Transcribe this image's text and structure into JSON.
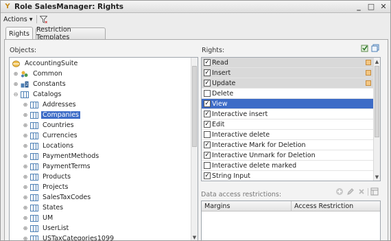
{
  "window": {
    "title": "Role SalesManager: Rights"
  },
  "toolbar": {
    "actions_label": "Actions ▾"
  },
  "tabs": [
    {
      "label": "Rights"
    },
    {
      "label": "Restriction Templates"
    }
  ],
  "objects_label": "Objects:",
  "rights_label": "Rights:",
  "tree": [
    {
      "label": "AccountingSuite"
    },
    {
      "label": "Common"
    },
    {
      "label": "Constants"
    },
    {
      "label": "Catalogs"
    },
    {
      "label": "Addresses"
    },
    {
      "label": "Companies"
    },
    {
      "label": "Countries"
    },
    {
      "label": "Currencies"
    },
    {
      "label": "Locations"
    },
    {
      "label": "PaymentMethods"
    },
    {
      "label": "PaymentTerms"
    },
    {
      "label": "Products"
    },
    {
      "label": "Projects"
    },
    {
      "label": "SalesTaxCodes"
    },
    {
      "label": "States"
    },
    {
      "label": "UM"
    },
    {
      "label": "UserList"
    },
    {
      "label": "USTaxCategories1099"
    }
  ],
  "rights": [
    {
      "label": "Read",
      "checked": true
    },
    {
      "label": "Insert",
      "checked": true
    },
    {
      "label": "Update",
      "checked": true
    },
    {
      "label": "Delete",
      "checked": false
    },
    {
      "label": "View",
      "checked": true
    },
    {
      "label": "Interactive insert",
      "checked": true
    },
    {
      "label": "Edit",
      "checked": true
    },
    {
      "label": "Interactive delete",
      "checked": false
    },
    {
      "label": "Interactive Mark for Deletion",
      "checked": true
    },
    {
      "label": "Interactive Unmark for Deletion",
      "checked": true
    },
    {
      "label": "Interactive delete marked",
      "checked": false
    },
    {
      "label": "String Input",
      "checked": true
    }
  ],
  "data_access": {
    "label": "Data access restrictions:",
    "columns": [
      "Margins",
      "Access Restriction"
    ]
  },
  "icons": {
    "window": "role-icon",
    "filter": "filter-icon",
    "minimize": "minimize-icon",
    "maximize": "maximize-icon",
    "close": "close-icon"
  },
  "colors": {
    "selection": "#3d6cc7",
    "marker": "#f3c682"
  }
}
